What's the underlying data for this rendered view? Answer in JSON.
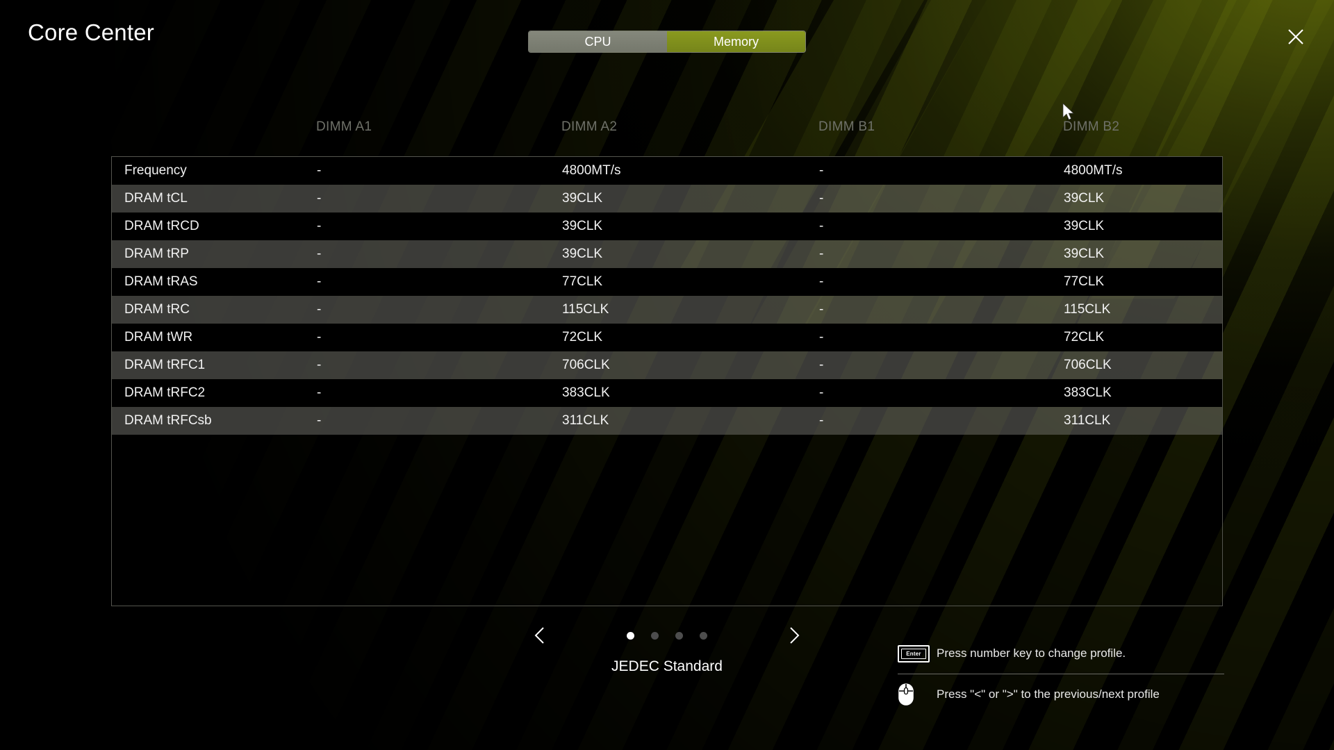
{
  "app": {
    "title": "Core Center"
  },
  "header": {
    "close_icon": "close-icon",
    "tabs": [
      {
        "label": "CPU",
        "active": false
      },
      {
        "label": "Memory",
        "active": true
      }
    ]
  },
  "table": {
    "columns": [
      "",
      "DIMM A1",
      "DIMM A2",
      "DIMM B1",
      "DIMM B2"
    ],
    "rows": [
      {
        "label": "Frequency",
        "a1": "-",
        "a2": "4800MT/s",
        "b1": "-",
        "b2": "4800MT/s"
      },
      {
        "label": "DRAM tCL",
        "a1": "-",
        "a2": "39CLK",
        "b1": "-",
        "b2": "39CLK"
      },
      {
        "label": "DRAM tRCD",
        "a1": "-",
        "a2": "39CLK",
        "b1": "-",
        "b2": "39CLK"
      },
      {
        "label": "DRAM tRP",
        "a1": "-",
        "a2": "39CLK",
        "b1": "-",
        "b2": "39CLK"
      },
      {
        "label": "DRAM tRAS",
        "a1": "-",
        "a2": "77CLK",
        "b1": "-",
        "b2": "77CLK"
      },
      {
        "label": "DRAM tRC",
        "a1": "-",
        "a2": "115CLK",
        "b1": "-",
        "b2": "115CLK"
      },
      {
        "label": "DRAM tWR",
        "a1": "-",
        "a2": "72CLK",
        "b1": "-",
        "b2": "72CLK"
      },
      {
        "label": "DRAM tRFC1",
        "a1": "-",
        "a2": "706CLK",
        "b1": "-",
        "b2": "706CLK"
      },
      {
        "label": "DRAM tRFC2",
        "a1": "-",
        "a2": "383CLK",
        "b1": "-",
        "b2": "383CLK"
      },
      {
        "label": "DRAM tRFCsb",
        "a1": "-",
        "a2": "311CLK",
        "b1": "-",
        "b2": "311CLK"
      }
    ]
  },
  "profiles": {
    "prev_icon": "chevron-left-icon",
    "next_icon": "chevron-right-icon",
    "total": 4,
    "active_index": 0,
    "current_name": "JEDEC Standard"
  },
  "help": {
    "items": [
      {
        "icon": "enter-key-icon",
        "key_label": "Enter",
        "text": "Press number key to change profile."
      },
      {
        "icon": "mouse-icon",
        "text": "Press \"<\" or \">\" to the previous/next profile"
      }
    ]
  },
  "colors": {
    "accent_olive": "#7d8c21",
    "tab_inactive": "#7d7f72",
    "row_alt": "#4a4a48",
    "row_base": "#000000",
    "header_text": "#6f7169",
    "table_border": "#55564f"
  }
}
